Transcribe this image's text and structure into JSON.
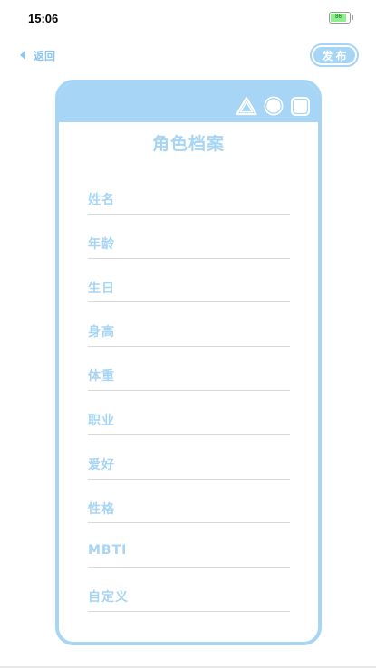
{
  "status_bar": {
    "time": "15:06",
    "battery_level": "86",
    "battery_percent": 0.86
  },
  "nav": {
    "back_label": "返回",
    "publish_label": "发布"
  },
  "card": {
    "title": "角色档案",
    "fields": [
      {
        "label": "姓名"
      },
      {
        "label": "年龄"
      },
      {
        "label": "生日"
      },
      {
        "label": "身高"
      },
      {
        "label": "体重"
      },
      {
        "label": "职业"
      },
      {
        "label": "爱好"
      },
      {
        "label": "性格"
      },
      {
        "label": "MBTI"
      },
      {
        "label": "自定义"
      }
    ],
    "header_icons": [
      "triangle-icon",
      "circle-icon",
      "square-icon"
    ]
  },
  "colors": {
    "accent": "#a6d5f5",
    "back_text": "#8cc6f0",
    "divider": "#d8d8d8",
    "battery_fill": "#8df08d"
  }
}
